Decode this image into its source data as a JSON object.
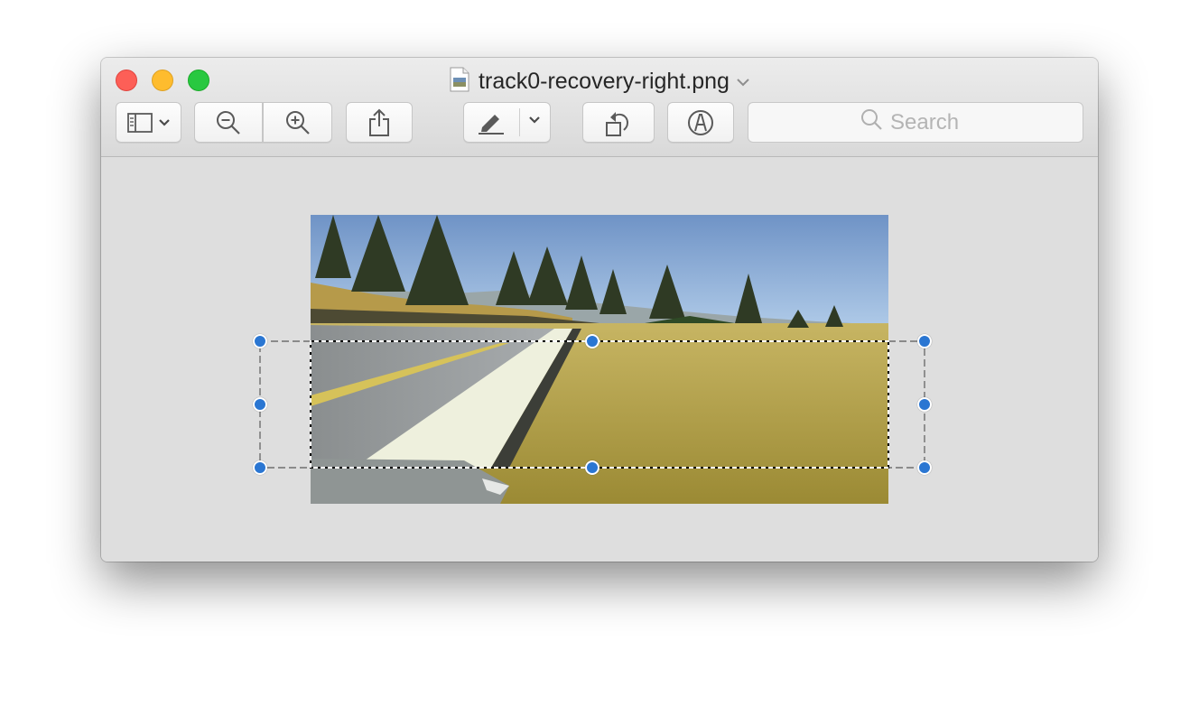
{
  "window": {
    "title": "track0-recovery-right.png"
  },
  "toolbar": {
    "sidebar_button": "sidebar-icon",
    "zoom_out": "zoom-out-icon",
    "zoom_in": "zoom-in-icon",
    "share": "share-icon",
    "markup_highlight": "highlight-pen-icon",
    "rotate": "rotate-left-icon",
    "markup": "markup-icon"
  },
  "search": {
    "placeholder": "Search"
  },
  "colors": {
    "selection_handle": "#2a76d2",
    "close": "#fd5f57",
    "minimize": "#febc2e",
    "maximize": "#28c840"
  }
}
